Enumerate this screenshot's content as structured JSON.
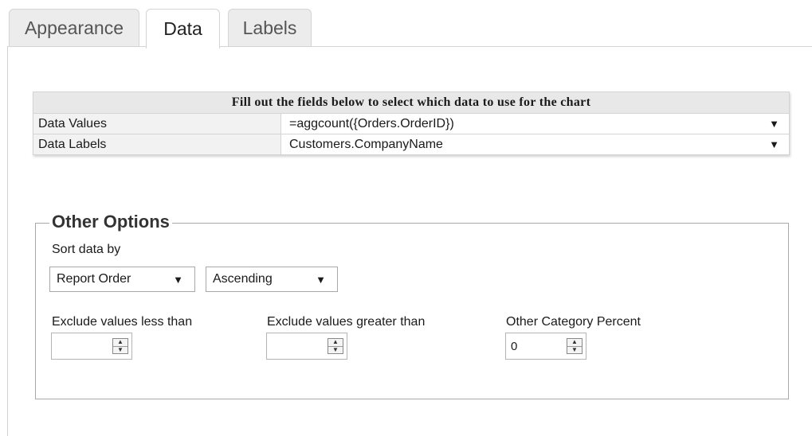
{
  "tabs": [
    {
      "label": "Appearance"
    },
    {
      "label": "Data"
    },
    {
      "label": "Labels"
    }
  ],
  "data_table": {
    "caption": "Fill out the fields below to select which data to use for the chart",
    "rows": [
      {
        "label": "Data Values",
        "value": "=aggcount({Orders.OrderID})"
      },
      {
        "label": "Data Labels",
        "value": "Customers.CompanyName"
      }
    ]
  },
  "other_options": {
    "legend": "Other Options",
    "sort_label": "Sort data by",
    "sort_by": "Report Order",
    "sort_direction": "Ascending",
    "exclude_less_label": "Exclude values less than",
    "exclude_less_value": "",
    "exclude_greater_label": "Exclude values greater than",
    "exclude_greater_value": "",
    "other_category_label": "Other Category Percent",
    "other_category_value": "0"
  },
  "icons": {
    "dropdown": "▼",
    "spin_up": "▲",
    "spin_down": "▼"
  }
}
